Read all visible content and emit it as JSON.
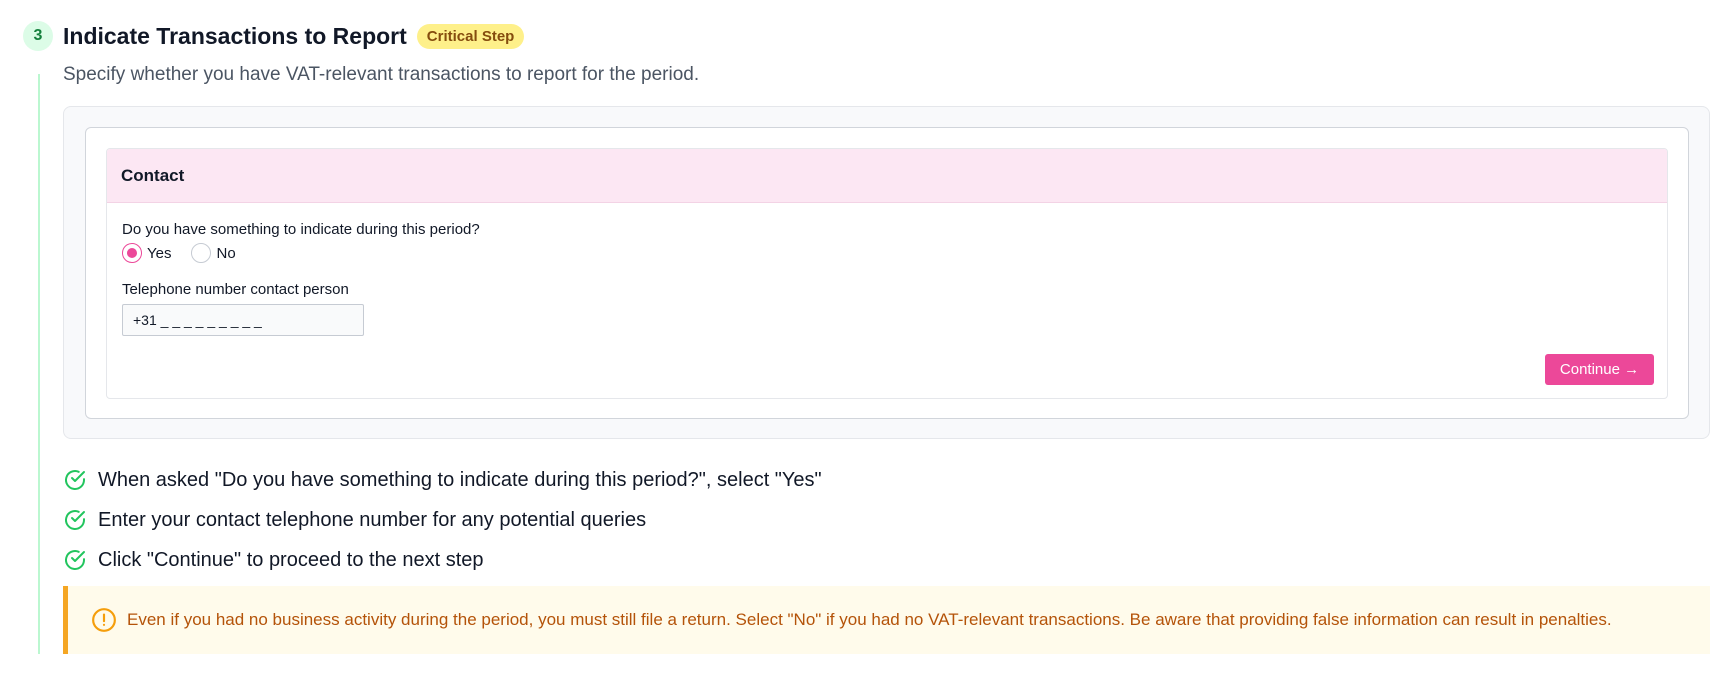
{
  "step": {
    "number": "3",
    "title": "Indicate Transactions to Report",
    "badge": "Critical Step",
    "description": "Specify whether you have VAT-relevant transactions to report for the period."
  },
  "form": {
    "section_title": "Contact",
    "question": "Do you have something to indicate during this period?",
    "options": [
      {
        "label": "Yes",
        "selected": true
      },
      {
        "label": "No",
        "selected": false
      }
    ],
    "telephone_label": "Telephone number contact person",
    "telephone_value": "+31 _ _ _ _ _ _ _ _ _",
    "continue_label": "Continue →"
  },
  "checklist": [
    "When asked \"Do you have something to indicate during this period?\", select \"Yes\"",
    "Enter your contact telephone number for any potential queries",
    "Click \"Continue\" to proceed to the next step"
  ],
  "warning": {
    "text": "Even if you had no business activity during the period, you must still file a return. Select \"No\" if you had no VAT-relevant transactions. Be aware that providing false information can result in penalties."
  },
  "colors": {
    "accent": "#ec4899",
    "step_badge_bg": "#dcfce7",
    "step_badge_text": "#15803d",
    "critical_badge_bg": "#fef08a",
    "check_green": "#22c55e",
    "warning_border": "#f5a623",
    "warning_text": "#b45309",
    "form_header_bg": "#fce7f3"
  },
  "icons": {
    "check": "circle-check-icon",
    "warning": "alert-circle-icon"
  }
}
